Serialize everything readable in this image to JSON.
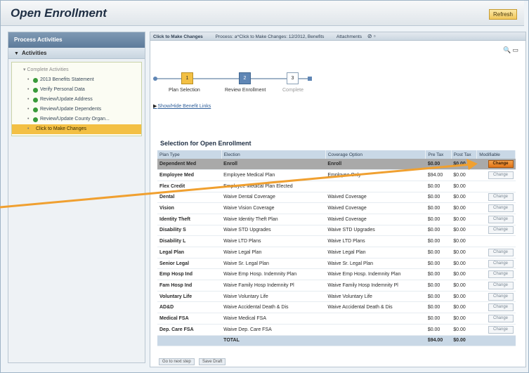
{
  "app": {
    "title": "Open Enrollment",
    "refresh_label": "Refresh"
  },
  "toolbar": {
    "items": [
      "Click to Make Changes",
      "Process: a^Click to Make Changes: 12/2012, Benefits",
      "Attachments"
    ]
  },
  "sidebar": {
    "header": "Process Activities",
    "activities_label": "Activities",
    "root": "Complete Activities",
    "items": [
      {
        "label": "2013 Benefits Statement",
        "status": "done"
      },
      {
        "label": "Verify Personal Data",
        "status": "done"
      },
      {
        "label": "Review/Update Address",
        "status": "done"
      },
      {
        "label": "Review/Update Dependents",
        "status": "done"
      },
      {
        "label": "Review/Update County Organ...",
        "status": "done"
      },
      {
        "label": "Click to Make Changes",
        "status": "active"
      }
    ]
  },
  "roadmap": {
    "steps": [
      {
        "number": "1",
        "label": "Plan Selection"
      },
      {
        "number": "2",
        "label": "Review Enrollment"
      },
      {
        "number": "3",
        "label": "Complete"
      }
    ]
  },
  "links": {
    "benefit_links": "Show/Hide Benefit Links"
  },
  "selection": {
    "title": "Selection for Open Enrollment",
    "columns": [
      "Plan Type",
      "Election",
      "Coverage Option",
      "Pre Tax",
      "Post Tax",
      "Modifiable"
    ],
    "rows": [
      {
        "plan": "Dependent Med",
        "election": "Enroll",
        "coverage": "Enroll",
        "pre": "$0.00",
        "post": "$0.00",
        "change": "Change",
        "highlight": true
      },
      {
        "plan": "Employee Med",
        "election": "Employee Medical Plan",
        "coverage": "Employee Only",
        "pre": "$94.00",
        "post": "$0.00",
        "change": "Change"
      },
      {
        "plan": "Flex Credit",
        "election": "Employee Medical Plan Elected",
        "coverage": "",
        "pre": "$0.00",
        "post": "$0.00",
        "change": ""
      },
      {
        "plan": "Dental",
        "election": "Waive Dental Coverage",
        "coverage": "Waived Coverage",
        "pre": "$0.00",
        "post": "$0.00",
        "change": "Change"
      },
      {
        "plan": "Vision",
        "election": "Waive Vision Coverage",
        "coverage": "Waived Coverage",
        "pre": "$0.00",
        "post": "$0.00",
        "change": "Change"
      },
      {
        "plan": "Identity Theft",
        "election": "Waive Identity Theft Plan",
        "coverage": "Waived Coverage",
        "pre": "$0.00",
        "post": "$0.00",
        "change": "Change"
      },
      {
        "plan": "Disability S",
        "election": "Waive STD Upgrades",
        "coverage": "Waive STD Upgrades",
        "pre": "$0.00",
        "post": "$0.00",
        "change": "Change"
      },
      {
        "plan": "Disability L",
        "election": "Waive LTD Plans",
        "coverage": "Waive LTD Plans",
        "pre": "$0.00",
        "post": "$0.00",
        "change": ""
      },
      {
        "plan": "Legal Plan",
        "election": "Waive Legal Plan",
        "coverage": "Waive Legal Plan",
        "pre": "$0.00",
        "post": "$0.00",
        "change": "Change"
      },
      {
        "plan": "Senior Legal",
        "election": "Waive Sr. Legal Plan",
        "coverage": "Waive Sr. Legal Plan",
        "pre": "$0.00",
        "post": "$0.00",
        "change": "Change"
      },
      {
        "plan": "Emp Hosp Ind",
        "election": "Waive Emp Hosp. Indemnity Plan",
        "coverage": "Waive Emp Hosp. Indemnity Plan",
        "pre": "$0.00",
        "post": "$0.00",
        "change": "Change"
      },
      {
        "plan": "Fam Hosp Ind",
        "election": "Waive Family Hosp Indemnity Pl",
        "coverage": "Waive Family Hosp Indemnity Pl",
        "pre": "$0.00",
        "post": "$0.00",
        "change": "Change"
      },
      {
        "plan": "Voluntary Life",
        "election": "Waive Voluntary Life",
        "coverage": "Waive Voluntary Life",
        "pre": "$0.00",
        "post": "$0.00",
        "change": "Change"
      },
      {
        "plan": "AD&D",
        "election": "Waive Accidental Death & Dis",
        "coverage": "Waive Accidental Death & Dis",
        "pre": "$0.00",
        "post": "$0.00",
        "change": "Change"
      },
      {
        "plan": "Medical FSA",
        "election": "Waive Medical FSA",
        "coverage": "",
        "pre": "$0.00",
        "post": "$0.00",
        "change": "Change"
      },
      {
        "plan": "Dep. Care FSA",
        "election": "Waive Dep. Care FSA",
        "coverage": "",
        "pre": "$0.00",
        "post": "$0.00",
        "change": "Change"
      }
    ],
    "total": {
      "label": "TOTAL",
      "pre": "$94.00",
      "post": "$0.00"
    }
  },
  "bottom_buttons": [
    "Go to next step",
    "Save Draft"
  ],
  "colors": {
    "accent": "#f3c044",
    "pointer": "#f0a030",
    "header": "#5d7b9a"
  }
}
